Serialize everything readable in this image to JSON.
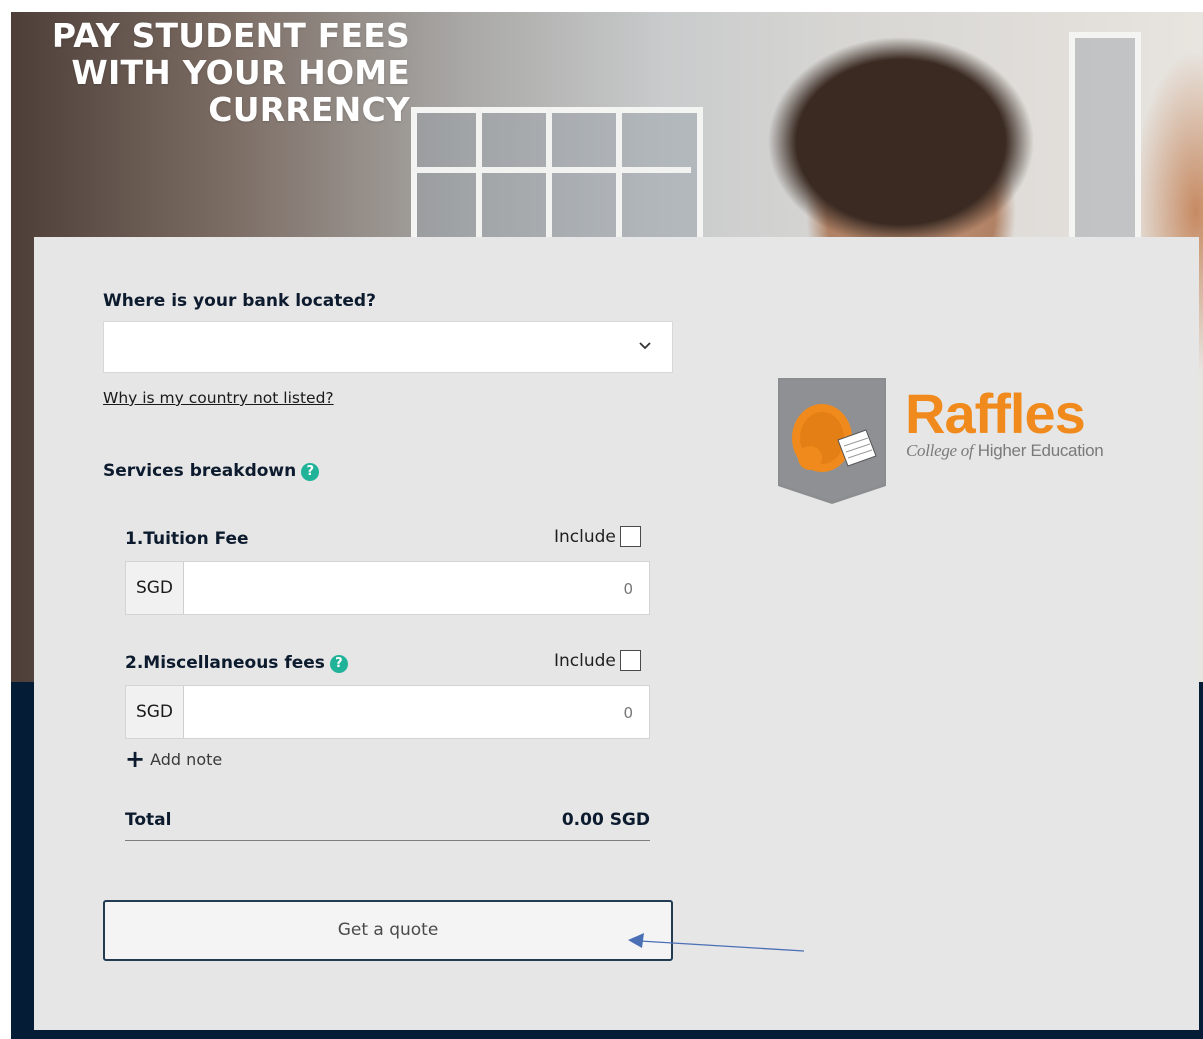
{
  "hero": {
    "title_line1": "PAY STUDENT FEES",
    "title_line2": "WITH YOUR HOME",
    "title_line3": "CURRENCY"
  },
  "form": {
    "bank_label": "Where is your bank located?",
    "bank_select_value": "",
    "country_link": "Why is my country not listed?",
    "services_label": "Services breakdown",
    "help_glyph": "?",
    "items": [
      {
        "label": "1.Tuition Fee",
        "include_label": "Include",
        "currency": "SGD",
        "placeholder": "0"
      },
      {
        "label": "2.Miscellaneous fees",
        "include_label": "Include",
        "currency": "SGD",
        "placeholder": "0"
      }
    ],
    "add_note_icon": "+",
    "add_note_label": "Add note",
    "total_label": "Total",
    "total_value": "0.00 SGD",
    "quote_button": "Get a quote"
  },
  "logo": {
    "word": "Raffles",
    "sub_italic": "College of",
    "sub_rest": "Higher Education"
  },
  "colors": {
    "accent": "#20b39a",
    "brand_orange": "#f08a1c",
    "navy": "#041c35",
    "card": "#e6e6e6"
  }
}
